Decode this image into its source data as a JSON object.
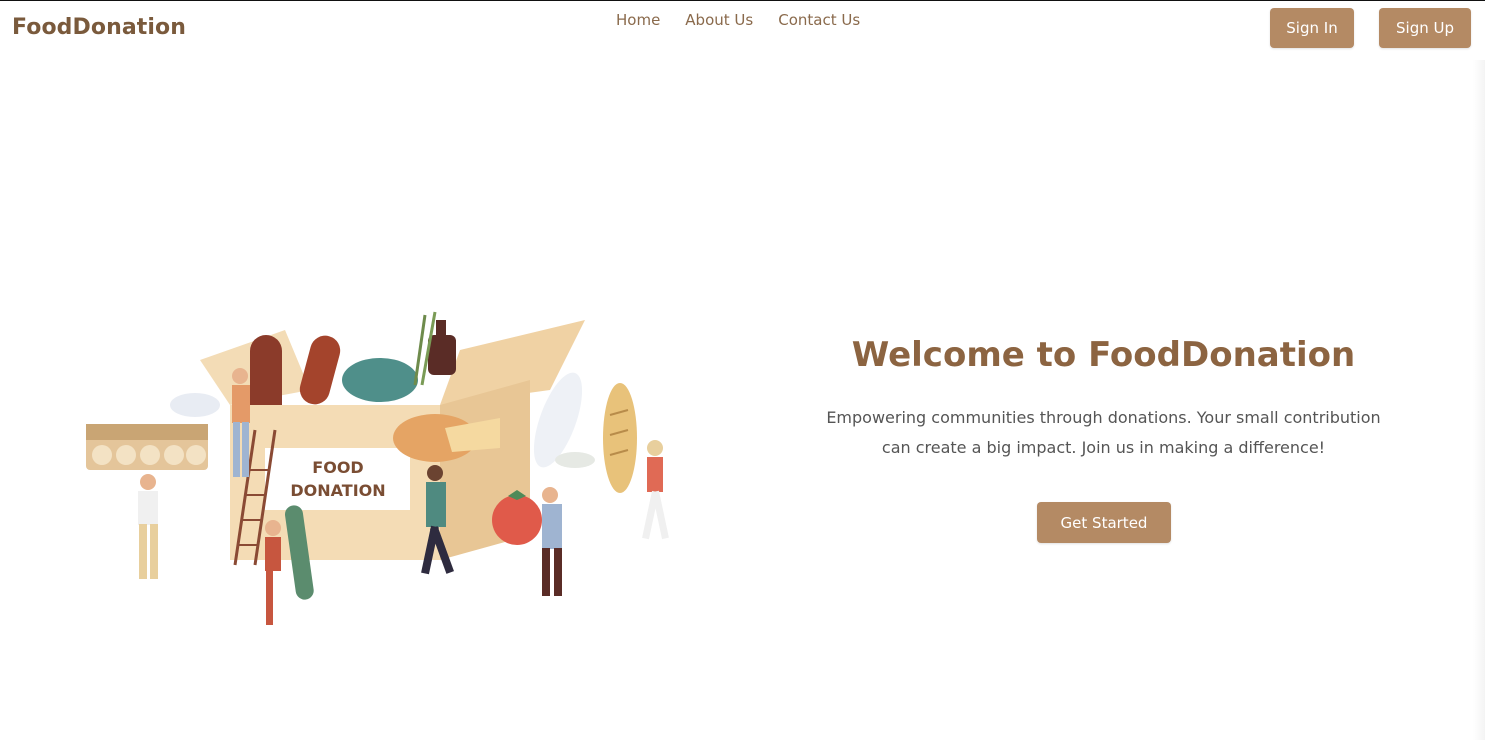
{
  "header": {
    "brand": "FoodDonation",
    "nav": [
      "Home",
      "About Us",
      "Contact Us"
    ],
    "sign_in_label": "Sign In",
    "sign_up_label": "Sign Up"
  },
  "hero": {
    "title": "Welcome to FoodDonation",
    "text_line1": "Empowering communities through donations. Your small contribution",
    "text_line2": "can create a big impact. Join us in making a difference!",
    "cta_label": "Get Started",
    "illustration_label_line1": "FOOD",
    "illustration_label_line2": "DONATION"
  },
  "colors": {
    "accent": "#b48a64",
    "title": "#8c6441",
    "brand": "#7a5a3c"
  }
}
